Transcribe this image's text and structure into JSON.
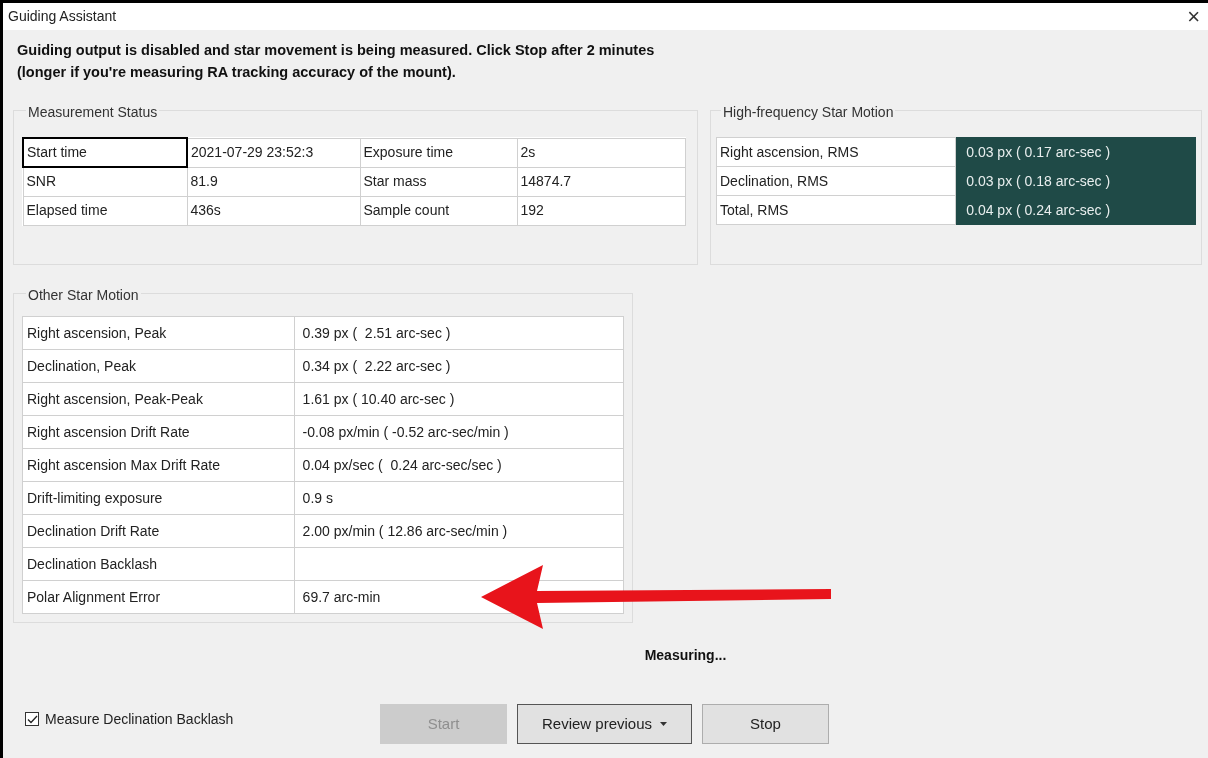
{
  "window": {
    "title": "Guiding Assistant",
    "close": "×"
  },
  "instructions": [
    "Guiding output is disabled and star movement is being measured.  Click Stop after 2 minutes",
    "(longer if you're measuring RA tracking accuracy of the mount)."
  ],
  "measurement_status": {
    "title": "Measurement Status",
    "rows": [
      [
        {
          "text": "Start time",
          "selected": true
        },
        {
          "text": "2021-07-29 23:52:3",
          "selected": false
        },
        {
          "text": "Exposure time",
          "selected": false
        },
        {
          "text": "2s",
          "selected": false
        }
      ],
      [
        {
          "text": "SNR",
          "selected": false
        },
        {
          "text": "81.9",
          "selected": false
        },
        {
          "text": "Star mass",
          "selected": false
        },
        {
          "text": "14874.7",
          "selected": false
        }
      ],
      [
        {
          "text": "Elapsed time",
          "selected": false
        },
        {
          "text": "436s",
          "selected": false
        },
        {
          "text": "Sample count",
          "selected": false
        },
        {
          "text": "192",
          "selected": false
        }
      ]
    ]
  },
  "high_frequency": {
    "title": "High-frequency Star Motion",
    "rows": [
      {
        "label": "Right ascension, RMS",
        "value": "0.03 px ( 0.17 arc-sec )",
        "selected": true
      },
      {
        "label": "Declination, RMS",
        "value": "0.03 px ( 0.18 arc-sec )",
        "selected": true
      },
      {
        "label": "Total, RMS",
        "value": "0.04 px ( 0.24 arc-sec )",
        "selected": true
      }
    ]
  },
  "other_motion": {
    "title": "Other Star Motion",
    "rows": [
      {
        "label": "Right ascension, Peak",
        "value": "0.39 px (  2.51 arc-sec )"
      },
      {
        "label": "Declination, Peak",
        "value": "0.34 px (  2.22 arc-sec )"
      },
      {
        "label": "Right ascension, Peak-Peak",
        "value": "1.61 px ( 10.40 arc-sec )"
      },
      {
        "label": "Right ascension Drift Rate",
        "value": "-0.08 px/min ( -0.52 arc-sec/min )"
      },
      {
        "label": "Right ascension Max Drift Rate",
        "value": "0.04 px/sec (  0.24 arc-sec/sec )"
      },
      {
        "label": "Drift-limiting exposure",
        "value": "0.9 s"
      },
      {
        "label": "Declination Drift Rate",
        "value": "2.00 px/min ( 12.86 arc-sec/min )"
      },
      {
        "label": "Declination Backlash"
      },
      {
        "label": "Polar Alignment Error",
        "value": "69.7 arc-min"
      }
    ]
  },
  "status": "Measuring...",
  "backlash_checkbox": {
    "label": "Measure Declination Backlash",
    "checked": true
  },
  "buttons": [
    {
      "label": "Start",
      "kind": "button",
      "disabled": true,
      "focused": false
    },
    {
      "label": "Review previous",
      "kind": "dropdown",
      "disabled": false,
      "focused": true
    },
    {
      "label": "Stop",
      "kind": "button",
      "disabled": false,
      "focused": false
    }
  ]
}
